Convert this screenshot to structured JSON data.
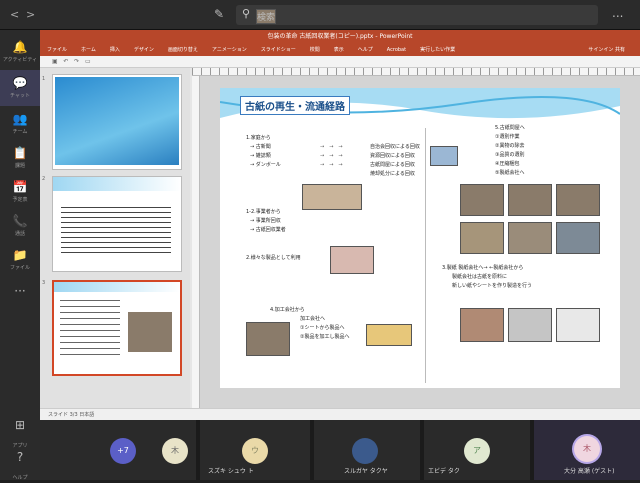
{
  "topbar": {
    "back": "<",
    "forward": ">",
    "search_placeholder": "検索",
    "more": "..."
  },
  "rail": [
    {
      "glyph": "🔔",
      "label": "アクティビティ"
    },
    {
      "glyph": "💬",
      "label": "チャット"
    },
    {
      "glyph": "👥",
      "label": "チーム"
    },
    {
      "glyph": "📋",
      "label": "課題"
    },
    {
      "glyph": "📅",
      "label": "予定表"
    },
    {
      "glyph": "📞",
      "label": "通話"
    },
    {
      "glyph": "📁",
      "label": "ファイル"
    },
    {
      "glyph": "···",
      "label": ""
    }
  ],
  "rail_bottom": [
    {
      "glyph": "⊞",
      "label": "アプリ"
    },
    {
      "glyph": "?",
      "label": "ヘルプ"
    }
  ],
  "ppt": {
    "window_title": "包装の革命 古紙回収業者(コピー).pptx - PowerPoint",
    "tabs": [
      "ファイル",
      "ホーム",
      "挿入",
      "デザイン",
      "画面切り替え",
      "アニメーション",
      "スライドショー",
      "校閲",
      "表示",
      "ヘルプ",
      "Acrobat",
      "実行したい作業"
    ],
    "tabs_right": "サインイン  共有",
    "status": "スライド 3/3   日本語",
    "slide_numbers": [
      "1",
      "2",
      "3"
    ]
  },
  "slide": {
    "title": "古紙の再生・流通経路",
    "left_lines": [
      "1.家庭から",
      "→ 古新聞",
      "→ 雑誌類",
      "→ ダンボール"
    ],
    "mid_lines": [
      "自治会回収による回収",
      "資源回収による回収",
      "古紙問屋による回収",
      "焼却処分による回収"
    ],
    "block2": [
      "1-2.事業者から",
      "→ 事業所回収",
      "→ 古紙回収業者"
    ],
    "block3": "2.様々な製品として利用",
    "block4": [
      "4.加工会社から",
      "加工会社へ",
      "①シートから製品へ",
      "②製品を加工し製品へ"
    ],
    "right_lines": [
      "5.古紙問屋へ",
      "①選別作業",
      "②異物の除去",
      "③品質の選別",
      "④圧縮梱包",
      "⑤製紙会社へ"
    ],
    "block6": [
      "3.製紙 製紙会社へ→ ←製紙会社から",
      "製紙会社は古紙を原料に",
      "新しい紙やシートを作り製造を行う"
    ]
  },
  "participants": [
    {
      "initial": "+7",
      "name": "",
      "color": "#5b5fc7"
    },
    {
      "initial": "木",
      "name": "",
      "color": "#e8e3c8"
    },
    {
      "initial": "ウ",
      "name": "スズキ シュウ ト",
      "color": "#ead9a8"
    },
    {
      "initial": "",
      "name": "スルガヤ タクヤ",
      "color": "#3b5a8c"
    },
    {
      "initial": "ア",
      "name": "エビデ タク",
      "color": "#e0e8d0"
    },
    {
      "initial": "木",
      "name": "大分 高瀬 (ゲスト)",
      "color": "#f0d6e0"
    }
  ]
}
